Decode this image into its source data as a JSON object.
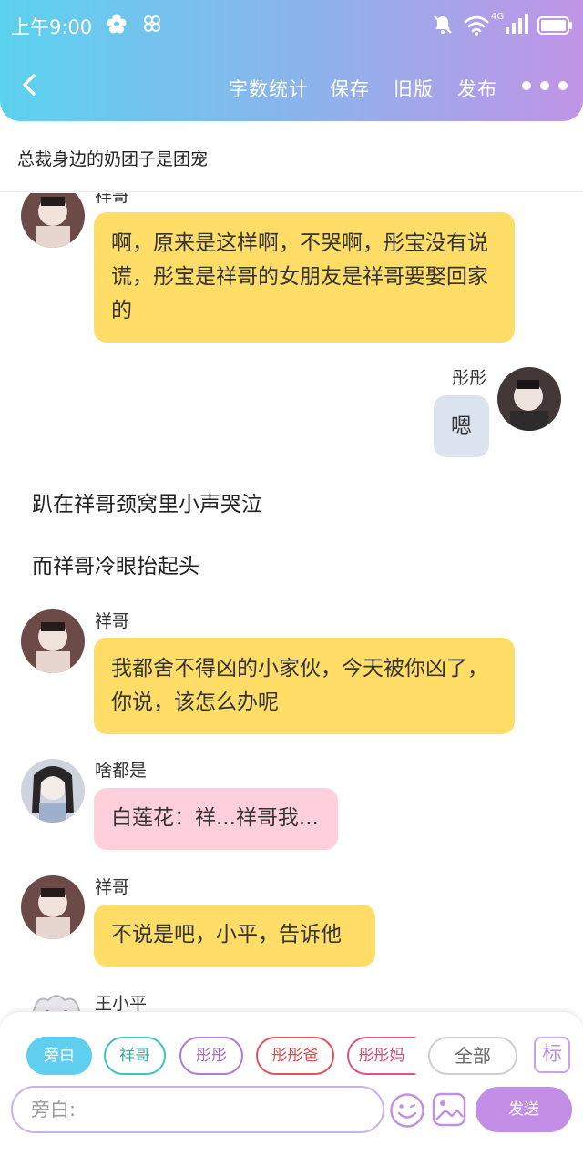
{
  "colors": {
    "header_gradient": [
      "#5bd2ee",
      "#8fb2ec",
      "#c194e6"
    ],
    "bubble_yellow": "#ffdd66",
    "bubble_gray": "#dbe3ee",
    "bubble_pink": "#ffd0dc",
    "accent_send": "#c38fe6",
    "chip_active": "#5fcff0"
  },
  "status_bar": {
    "time": "上午9:00",
    "network": "4G",
    "icons": [
      "flower-icon",
      "clover-icon",
      "bell-muted-icon",
      "wifi-icon",
      "signal-icon",
      "battery-icon"
    ]
  },
  "nav": {
    "back_icon": "chevron-left-icon",
    "word_count": "字数统计",
    "save": "保存",
    "old_version": "旧版",
    "publish": "发布",
    "more_icon": "more-dots-icon"
  },
  "document_title": "总裁身边的奶团子是团宠",
  "messages": [
    {
      "type": "left",
      "name": "祥哥",
      "text": "啊，原来是这样啊，不哭啊，彤宝没有说谎，彤宝是祥哥的女朋友是祥哥要娶回家的"
    },
    {
      "type": "right",
      "name": "彤彤",
      "text": "嗯"
    },
    {
      "type": "narration",
      "text": "趴在祥哥颈窝里小声哭泣"
    },
    {
      "type": "narration",
      "text": "而祥哥冷眼抬起头"
    },
    {
      "type": "left",
      "name": "祥哥",
      "text": "我都舍不得凶的小家伙，今天被你凶了，你说，该怎么办呢"
    },
    {
      "type": "left",
      "name": "啥都是",
      "text": "白莲花：祥...祥哥我..."
    },
    {
      "type": "left",
      "name": "祥哥",
      "text": "不说是吧，小平，告诉他"
    },
    {
      "type": "left",
      "name": "王小平",
      "text": ""
    }
  ],
  "roles": [
    {
      "label": "旁白",
      "active": true,
      "color": "#5fcff0"
    },
    {
      "label": "祥哥",
      "active": false,
      "color": "#3cc3c0"
    },
    {
      "label": "彤彤",
      "active": false,
      "color": "#b07ad8"
    },
    {
      "label": "彤彤爸",
      "active": false,
      "color": "#e0535a"
    },
    {
      "label": "彤彤妈",
      "active": false,
      "color": "#e0537e"
    },
    {
      "label": "全部",
      "active": false,
      "color": "#cfcfcf"
    }
  ],
  "tag_button": "标",
  "input": {
    "placeholder": "旁白:"
  },
  "send_button": "发送",
  "bottom_icons": [
    "emoji-icon",
    "image-icon"
  ]
}
